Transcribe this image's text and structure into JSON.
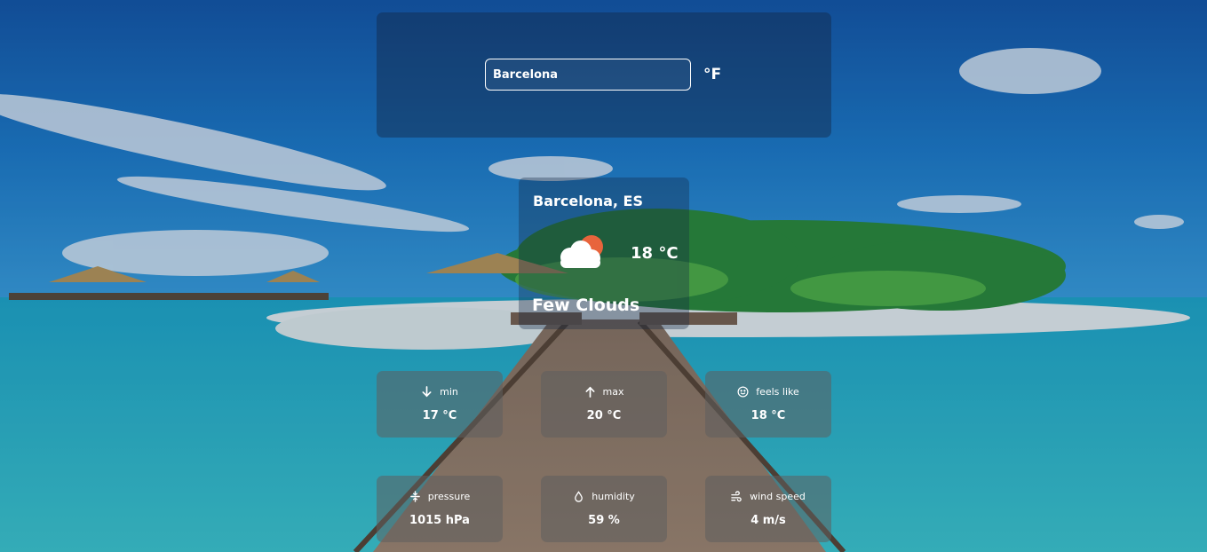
{
  "search": {
    "value": "Barcelona",
    "unit_toggle_label": "°F"
  },
  "current": {
    "location": "Barcelona, ES",
    "temperature": "18 °C",
    "description": "Few Clouds",
    "icon": "few-clouds-icon"
  },
  "stats": [
    {
      "icon": "arrow-down-icon",
      "label": "min",
      "value": "17 °C"
    },
    {
      "icon": "arrow-up-icon",
      "label": "max",
      "value": "20 °C"
    },
    {
      "icon": "smiley-icon",
      "label": "feels like",
      "value": "18 °C"
    },
    {
      "icon": "pressure-icon",
      "label": "pressure",
      "value": "1015 hPa"
    },
    {
      "icon": "droplet-icon",
      "label": "humidity",
      "value": "59 %"
    },
    {
      "icon": "wind-icon",
      "label": "wind speed",
      "value": "4 m/s"
    }
  ],
  "colors": {
    "sun": "#e8643c",
    "panel": "rgba(20,40,70,0.45)",
    "card": "rgba(95,95,95,0.55)"
  }
}
